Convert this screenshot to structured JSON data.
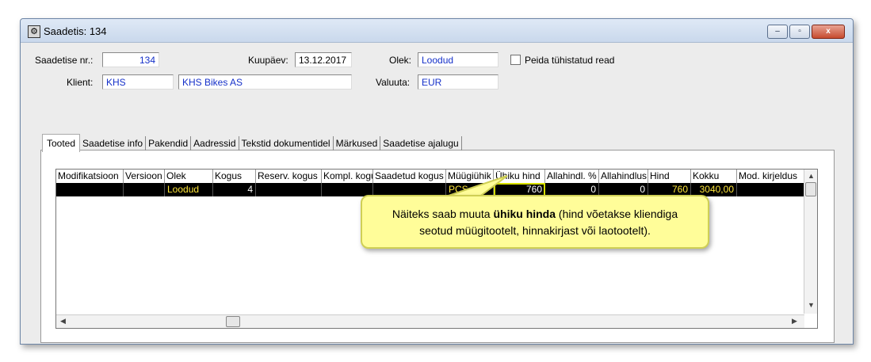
{
  "window": {
    "title": "Saadetis: 134",
    "buttons": {
      "minimize": "–",
      "maximize": "▫",
      "close": "x"
    }
  },
  "form": {
    "saadetise_nr_label": "Saadetise nr.:",
    "saadetise_nr_value": "134",
    "kuupaev_label": "Kuupäev:",
    "kuupaev_value": "13.12.2017",
    "olek_label": "Olek:",
    "olek_value": "Loodud",
    "peida_label": "Peida tühistatud read",
    "klient_label": "Klient:",
    "klient_code": "KHS",
    "klient_name": "KHS Bikes AS",
    "valuuta_label": "Valuuta:",
    "valuuta_value": "EUR"
  },
  "tabs": [
    {
      "label": "Tooted",
      "active": true
    },
    {
      "label": "Saadetise info"
    },
    {
      "label": "Pakendid"
    },
    {
      "label": "Aadressid"
    },
    {
      "label": "Tekstid dokumentidel"
    },
    {
      "label": "Märkused"
    },
    {
      "label": "Saadetise ajalugu"
    }
  ],
  "table": {
    "columns": [
      "Modifikatsioon",
      "Versioon",
      "Olek",
      "Kogus",
      "Reserv. kogus",
      "Kompl. kogu",
      "Saadetud kogus",
      "Müügiühik",
      "Ühiku hind",
      "Allahindl. %",
      "Allahindlus",
      "Hind",
      "Kokku",
      "Mod. kirjeldus"
    ],
    "rows": [
      [
        "",
        "",
        "Loodud",
        "4",
        "",
        "",
        "",
        "PCS",
        "760",
        "0",
        "0",
        "760",
        "3040,00",
        ""
      ]
    ]
  },
  "callout": {
    "text_before": "Näiteks saab muuta ",
    "text_bold": "ühiku hinda",
    "text_after": " (hind võetakse kliendiga",
    "line2": "seotud müügitootelt, hinnakirjast või laotootelt)."
  },
  "colors": {
    "row_bg": "#000000",
    "row_text": "#ffe63a",
    "field_text": "#1530c9",
    "callout_bg": "#fffd99"
  }
}
